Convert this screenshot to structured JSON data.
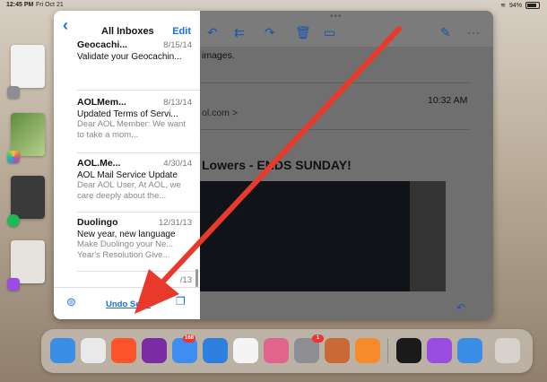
{
  "status": {
    "time": "12:45 PM",
    "date": "Fri Oct 21",
    "battery": "94%"
  },
  "mail": {
    "header": {
      "title": "All Inboxes",
      "edit": "Edit"
    },
    "messages": [
      {
        "from": "Geocachi...",
        "date": "8/15/14",
        "subject": "Validate your Geocachin...",
        "preview": ""
      },
      {
        "from": "AOLMem...",
        "date": "8/13/14",
        "subject": "Updated Terms of Servi...",
        "preview": "Dear AOL Member: We want to take a mom..."
      },
      {
        "from": "AOL.Me...",
        "date": "4/30/14",
        "subject": "AOL Mail Service Update",
        "preview": "Dear AOL User, At AOL, we care deeply about the..."
      },
      {
        "from": "Duolingo",
        "date": "12/31/13",
        "subject": "New year, new language",
        "preview": "Make Duolingo your Ne... Year's Resolution Give..."
      },
      {
        "from": "",
        "date": "/13",
        "subject": "",
        "preview": ""
      }
    ],
    "footer": {
      "undo": "Undo Send"
    },
    "detail": {
      "line1": "images.",
      "time": "10:32 AM",
      "sender": "ol.com >",
      "headline": "Lowers - ENDS SUNDAY!"
    }
  },
  "dock": {
    "apps": [
      {
        "name": "safari-app-icon",
        "color": "#3a8ee6"
      },
      {
        "name": "chrome-app-icon",
        "color": "#e9e9e9"
      },
      {
        "name": "brave-app-icon",
        "color": "#fb542b"
      },
      {
        "name": "tor-app-icon",
        "color": "#7a2ca3"
      },
      {
        "name": "mail-app-icon",
        "color": "#3d8ef0",
        "badge": "168"
      },
      {
        "name": "files-app-icon",
        "color": "#2f7fe0"
      },
      {
        "name": "photos-app-icon",
        "color": "#f4f4f4"
      },
      {
        "name": "shortcuts-app-icon",
        "color": "#e0648b"
      },
      {
        "name": "settings-app-icon",
        "color": "#8d8d92",
        "badge": "1"
      },
      {
        "name": "pencil-app-icon",
        "color": "#c96a36"
      },
      {
        "name": "overcast-app-icon",
        "color": "#f78b2a"
      },
      {
        "name": "spotify-app-icon",
        "color": "#1a1a1a"
      },
      {
        "name": "podcasts-app-icon",
        "color": "#9b4ce0"
      },
      {
        "name": "safari-app-icon-recent",
        "color": "#3a8ee6"
      },
      {
        "name": "app-library-icon",
        "color": "#d7d2cc"
      }
    ]
  }
}
